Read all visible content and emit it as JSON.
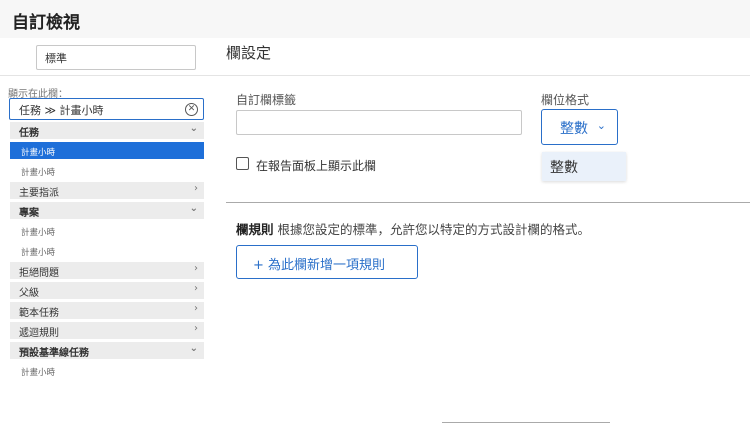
{
  "app": {
    "title": "自訂檢視"
  },
  "view_name": {
    "value": "標準"
  },
  "section_title": "欄設定",
  "sidebar": {
    "show_label": "顯示在此欄：",
    "path": {
      "text": "任務 ≫ 計畫小時"
    },
    "tree": [
      {
        "type": "group",
        "label": "任務",
        "bold": true,
        "chevron": "⌄"
      },
      {
        "type": "item",
        "label": "計畫小時",
        "selected": true
      },
      {
        "type": "item",
        "label": "計畫小時"
      },
      {
        "type": "group",
        "label": "主要指派",
        "chevron": "›"
      },
      {
        "type": "group",
        "label": "專案",
        "bold": true,
        "chevron": "⌄"
      },
      {
        "type": "item",
        "label": "計畫小時"
      },
      {
        "type": "item",
        "label": "計畫小時"
      },
      {
        "type": "group",
        "label": "拒絕問題",
        "chevron": "›"
      },
      {
        "type": "group",
        "label": "父級",
        "chevron": "›"
      },
      {
        "type": "group",
        "label": "範本任務",
        "chevron": "›"
      },
      {
        "type": "group",
        "label": "遞迴規則",
        "chevron": "›"
      },
      {
        "type": "group",
        "label": "預設基準線任務",
        "bold": true,
        "chevron": "⌄"
      },
      {
        "type": "item",
        "label": "計畫小時"
      }
    ]
  },
  "main": {
    "custom_label": "自訂欄標籤",
    "custom_label_value": "",
    "format_label": "欄位格式",
    "format_value": "整數",
    "format_options": [
      "整數"
    ],
    "checkbox_label": "在報告面板上顯示此欄",
    "checkbox_checked": false,
    "rules_title": "欄規則",
    "rules_desc": "根據您設定的標準，允許您以特定的方式設計欄的格式。",
    "add_rule_label": "+ 為此欄新增一項規則"
  },
  "colors": {
    "accent": "#1e6fd9",
    "header_bg": "#f7f7f7",
    "group_bg": "#ececec"
  }
}
